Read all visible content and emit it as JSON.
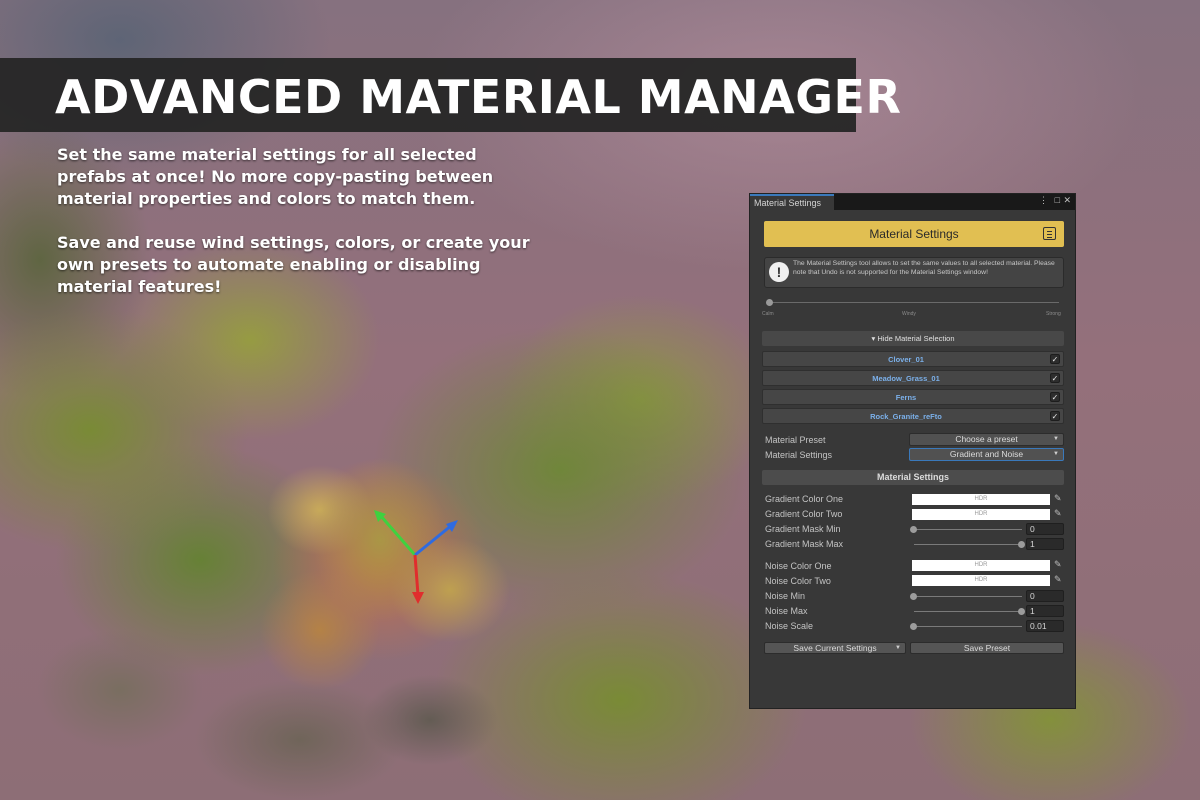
{
  "banner": {
    "title": "ADVANCED MATERIAL MANAGER",
    "paragraph1": "Set the same material settings for all selected prefabs at once! No more copy-pasting between material properties and colors to match them.",
    "paragraph2": "Save and reuse wind settings, colors, or create your own presets to automate enabling or disabling material features!"
  },
  "window": {
    "tab_label": "Material Settings",
    "controls": {
      "menu_icon": "vertical-ellipsis",
      "maximize_icon": "maximize",
      "close_icon": "close",
      "menu_glyph": "⋮",
      "maximize_glyph": "□",
      "close_glyph": "✕"
    },
    "header": {
      "title": "Material Settings",
      "accent_color": "#e1bf52",
      "icon": "document-menu"
    },
    "info": {
      "icon": "exclamation",
      "icon_glyph": "!",
      "text": "The Material Settings tool allows to set the same values to all selected material. Please note that Undo is not supported for the Material Settings window!"
    },
    "wind": {
      "value": 0,
      "labels": [
        "Calm",
        "Windy",
        "Strong"
      ]
    },
    "selection": {
      "toggle_label": "▾ Hide Material Selection",
      "items": [
        {
          "name": "Clover_01",
          "checked": true
        },
        {
          "name": "Meadow_Grass_01",
          "checked": true
        },
        {
          "name": "Ferns",
          "checked": true
        },
        {
          "name": "Rock_Granite_reFto",
          "checked": true
        }
      ],
      "check_glyph": "✓"
    },
    "preset": {
      "label": "Material Preset",
      "value": "Choose a preset"
    },
    "settings_mode": {
      "label": "Material Settings",
      "value": "Gradient and Noise"
    },
    "settings_header": "Material Settings",
    "properties": {
      "gradient_color_one": {
        "label": "Gradient Color One",
        "swatch_text": "HDR"
      },
      "gradient_color_two": {
        "label": "Gradient Color Two",
        "swatch_text": "HDR"
      },
      "gradient_mask_min": {
        "label": "Gradient Mask Min",
        "value": "0",
        "fraction": 0
      },
      "gradient_mask_max": {
        "label": "Gradient Mask Max",
        "value": "1",
        "fraction": 1
      },
      "noise_color_one": {
        "label": "Noise Color One",
        "swatch_text": "HDR"
      },
      "noise_color_two": {
        "label": "Noise Color Two",
        "swatch_text": "HDR"
      },
      "noise_min": {
        "label": "Noise Min",
        "value": "0",
        "fraction": 0
      },
      "noise_max": {
        "label": "Noise Max",
        "value": "1",
        "fraction": 1
      },
      "noise_scale": {
        "label": "Noise Scale",
        "value": "0.01",
        "fraction": 0
      }
    },
    "picker_glyph": "✎",
    "dropdown_glyph": "▼",
    "footer": {
      "save_current": "Save Current Settings",
      "save_preset": "Save Preset"
    }
  }
}
